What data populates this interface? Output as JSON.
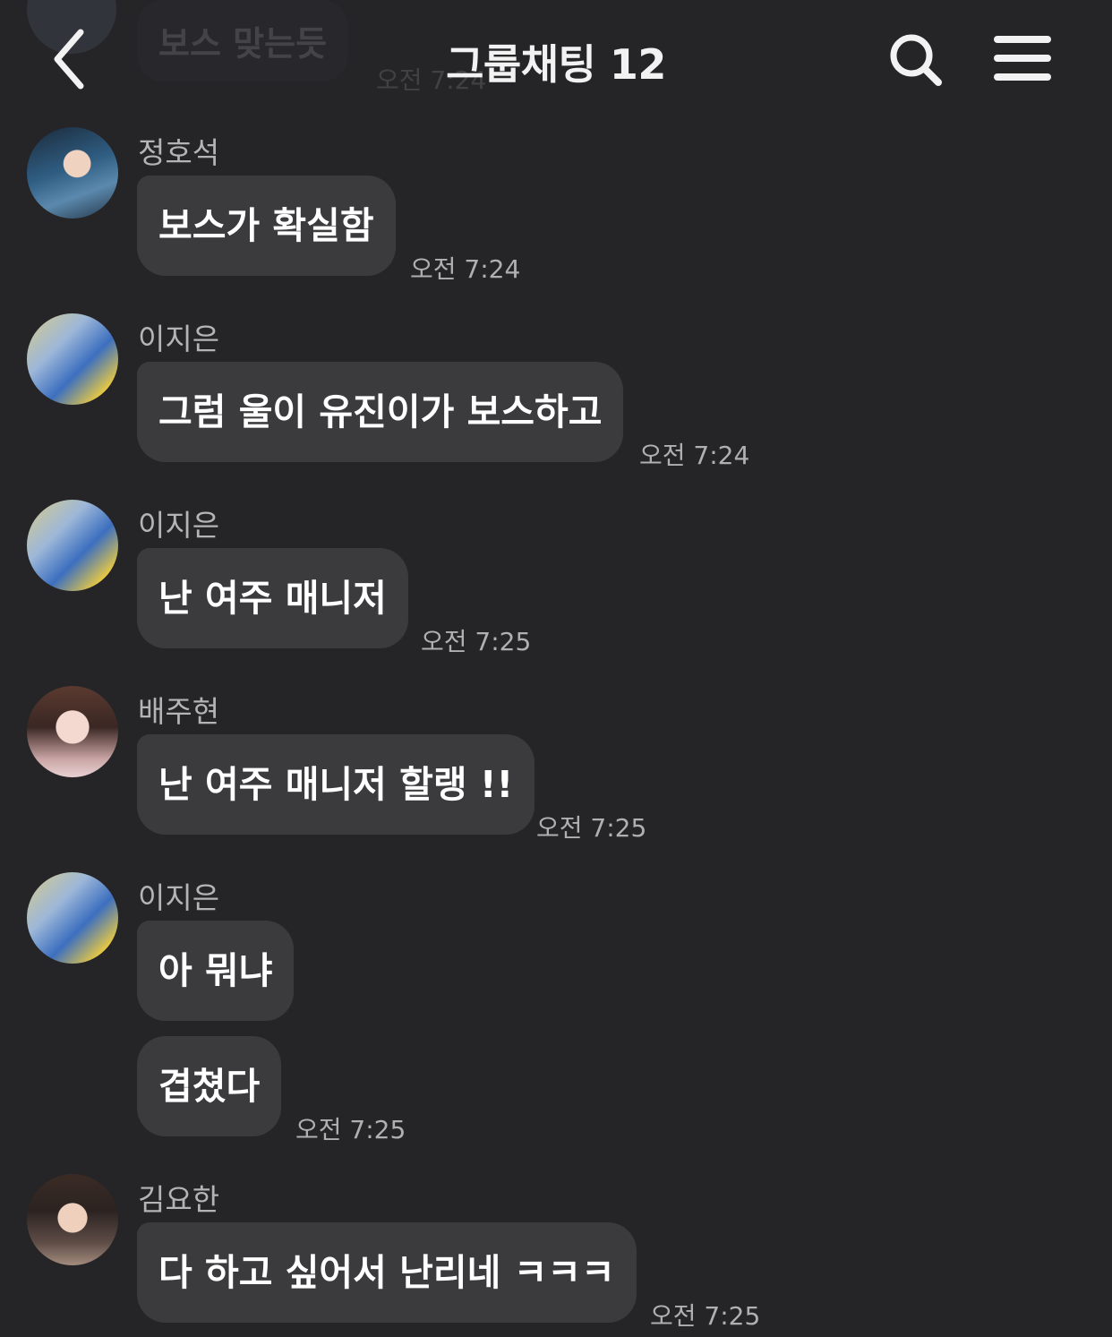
{
  "header": {
    "title": "그룹채팅 12",
    "back_icon": "chevron-left-icon",
    "search_icon": "search-icon",
    "menu_icon": "hamburger-menu-icon"
  },
  "previous_message": {
    "text": "보스 맞는듯",
    "time": "오전 7:24"
  },
  "messages": [
    {
      "sender": "정호석",
      "bubbles": [
        "보스가 확실함"
      ],
      "time": "오전 7:24"
    },
    {
      "sender": "이지은",
      "bubbles": [
        "그럼 울이 유진이가 보스하고"
      ],
      "time": "오전 7:24"
    },
    {
      "sender": "이지은",
      "bubbles": [
        "난 여주 매니저"
      ],
      "time": "오전 7:25"
    },
    {
      "sender": "배주현",
      "bubbles": [
        "난 여주 매니저 할랭 !!"
      ],
      "time": "오전 7:25"
    },
    {
      "sender": "이지은",
      "bubbles": [
        "아 뭐냐",
        "겹쳤다"
      ],
      "time": "오전 7:25"
    },
    {
      "sender": "김요한",
      "bubbles": [
        "다 하고 싶어서 난리네 ㅋㅋㅋ"
      ],
      "time": "오전 7:25"
    }
  ],
  "colors": {
    "background": "#252528",
    "bubble": "#3b3b3e",
    "sender_text": "#b4b4b6",
    "time_text": "#b0b0b2"
  }
}
